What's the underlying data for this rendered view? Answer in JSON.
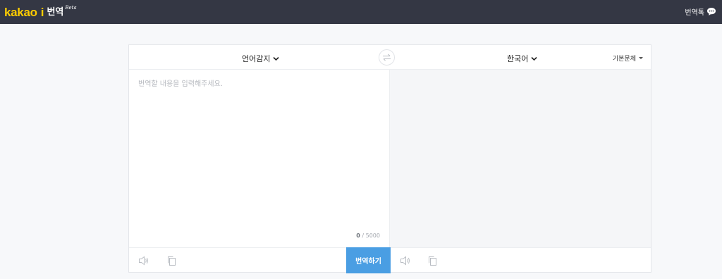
{
  "header": {
    "logo_brand": "kakao",
    "logo_i": "i",
    "logo_service": "번역",
    "logo_beta": "Beta",
    "talk_label": "번역톡",
    "talk_icon": "speech-bubble-icon"
  },
  "translator": {
    "source_lang": "언어감지",
    "target_lang": "한국어",
    "style_select": "기본문체",
    "swap_icon": "swap-arrows-icon",
    "input_placeholder": "번역할 내용을 입력해주세요.",
    "input_value": "",
    "char_count_current": "0",
    "char_count_max": "/ 5000",
    "translate_button": "번역하기",
    "source_tools": [
      "speaker-icon",
      "copy-icon"
    ],
    "target_tools": [
      "speaker-icon",
      "copy-icon"
    ]
  },
  "colors": {
    "topbar": "#343744",
    "logo_yellow": "#ffcd00",
    "accent_blue": "#4a9ee3",
    "target_bg": "#f5f6f8"
  }
}
